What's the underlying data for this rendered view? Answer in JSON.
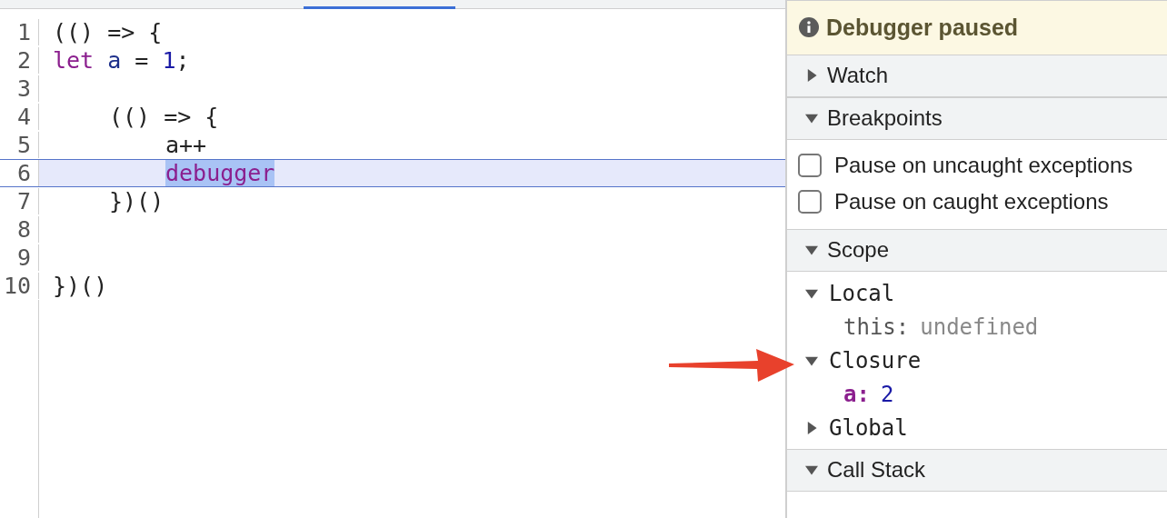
{
  "editor": {
    "lines": [
      {
        "number": "1",
        "current": false,
        "kind": "outer",
        "tokens": [
          {
            "text": "(() => {",
            "kind": "plain",
            "selected": false
          }
        ]
      },
      {
        "number": "2",
        "current": false,
        "kind": "outer",
        "tokens": [
          {
            "text": "let",
            "kind": "keyword",
            "selected": false
          },
          {
            "text": " a",
            "kind": "variable",
            "selected": false
          },
          {
            "text": " = ",
            "kind": "plain",
            "selected": false
          },
          {
            "text": "1",
            "kind": "number",
            "selected": false
          },
          {
            "text": ";",
            "kind": "plain",
            "selected": false
          }
        ]
      },
      {
        "number": "3",
        "current": false,
        "kind": "blank"
      },
      {
        "number": "4",
        "current": false,
        "kind": "nested",
        "tokens": [
          {
            "text": "(() => {",
            "kind": "plain",
            "selected": false
          }
        ]
      },
      {
        "number": "5",
        "current": false,
        "kind": "inner",
        "tokens": [
          {
            "text": "a++",
            "kind": "plain",
            "selected": false
          }
        ]
      },
      {
        "number": "6",
        "current": true,
        "kind": "inner",
        "tokens": [
          {
            "text": "debugger",
            "kind": "keyword",
            "selected": true
          }
        ]
      },
      {
        "number": "7",
        "current": false,
        "kind": "nested",
        "tokens": [
          {
            "text": "})()",
            "kind": "plain",
            "selected": false
          }
        ]
      },
      {
        "number": "8",
        "current": false,
        "kind": "blank"
      },
      {
        "number": "9",
        "current": false,
        "kind": "blank"
      },
      {
        "number": "10",
        "current": false,
        "kind": "outer",
        "tokens": [
          {
            "text": "})()",
            "kind": "plain",
            "selected": false
          }
        ]
      }
    ]
  },
  "sidebar": {
    "banner": "Debugger paused",
    "sections": [
      {
        "title": "Watch",
        "expanded": false
      },
      {
        "title": "Breakpoints",
        "expanded": true,
        "kind": "checkboxes",
        "options": [
          {
            "label": "Pause on uncaught exceptions",
            "checked": false
          },
          {
            "label": "Pause on caught exceptions",
            "checked": false
          }
        ]
      },
      {
        "title": "Scope",
        "expanded": true,
        "kind": "tree",
        "children": [
          {
            "name": "Local",
            "expanded": true,
            "children": [
              {
                "name": "this:",
                "value": "undefined",
                "kind": "special"
              }
            ]
          },
          {
            "name": "Closure",
            "expanded": true,
            "children": [
              {
                "name": "a:",
                "value": "2",
                "kind": "variable"
              }
            ]
          },
          {
            "name": "Global",
            "expanded": false
          }
        ]
      },
      {
        "title": "Call Stack",
        "expanded": true
      }
    ]
  }
}
